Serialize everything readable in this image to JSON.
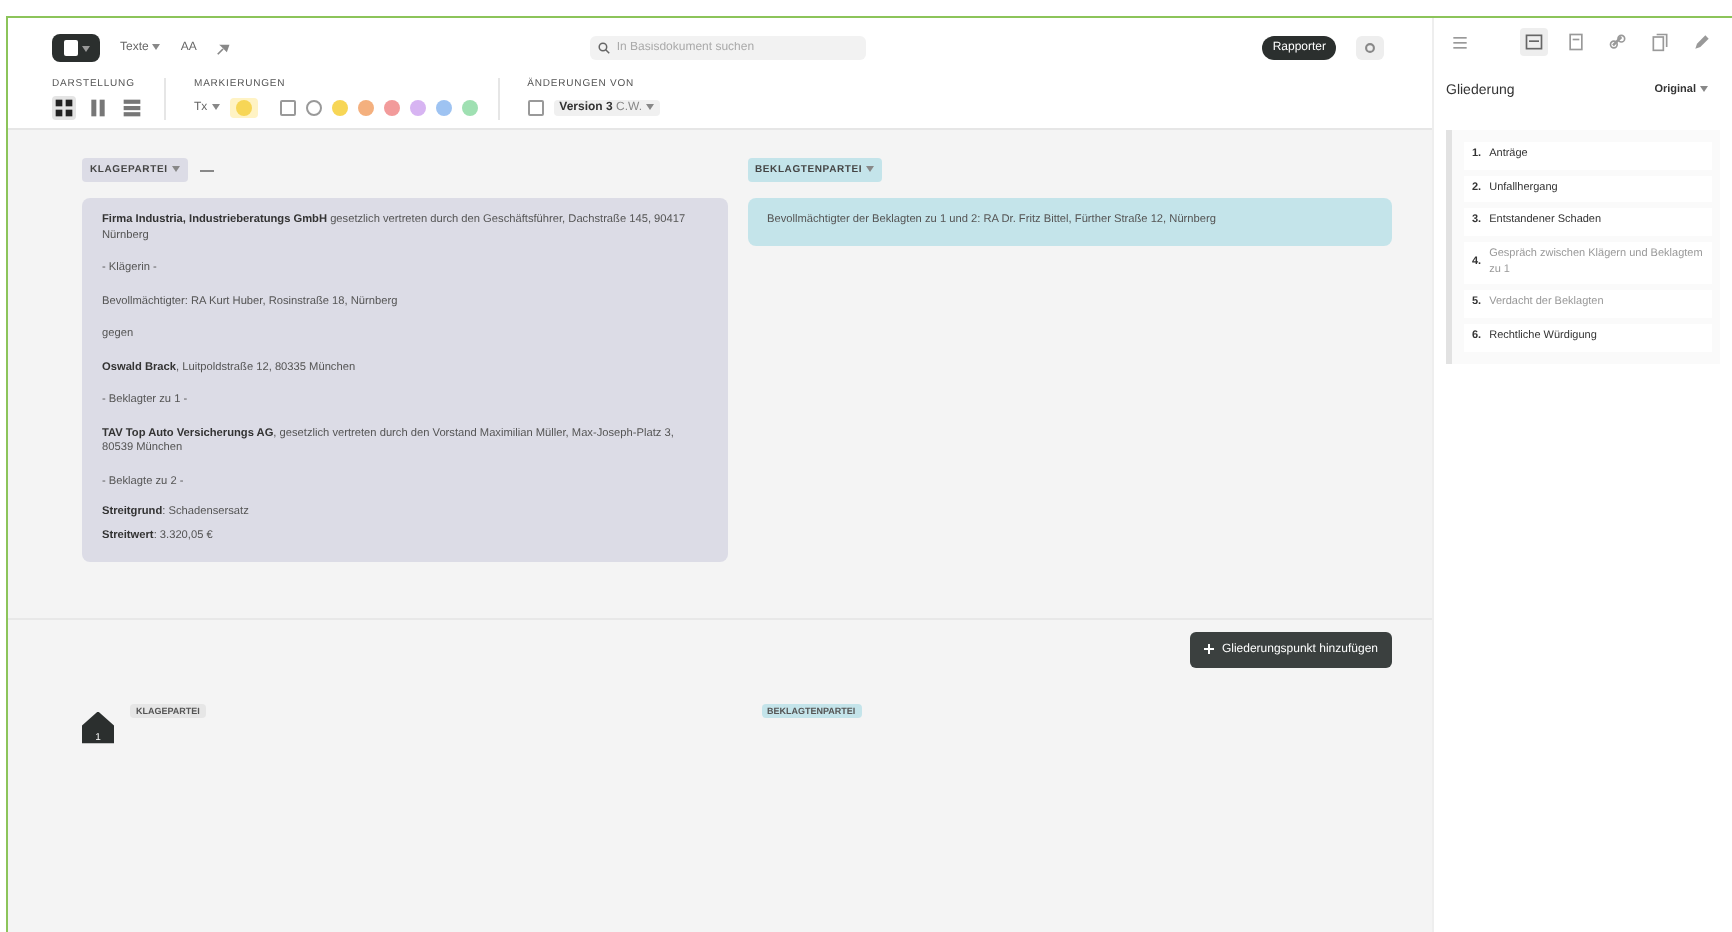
{
  "toolbar": {
    "document_menu": "Texte",
    "text_size": "AA",
    "search": {
      "placeholder": "In Basisdokument suchen"
    },
    "report_button": "Rapporter"
  },
  "view_group": {
    "label": "DARSTELLUNG",
    "views": [
      {
        "kind": "grid",
        "selected": true
      },
      {
        "kind": "columns",
        "selected": false
      },
      {
        "kind": "rows",
        "selected": false
      }
    ]
  },
  "marker_group": {
    "label": "MARKIERUNGEN",
    "text_style": "Tx",
    "pens": [
      {
        "color": "#f7d656"
      }
    ],
    "toggles": [
      {
        "kind": "square",
        "checked": false
      },
      {
        "kind": "round",
        "checked": false
      }
    ],
    "colors": [
      {
        "color": "#f7d656"
      },
      {
        "color": "#f4b07e"
      },
      {
        "color": "#f29b9b"
      },
      {
        "color": "#d7b4f2"
      },
      {
        "color": "#9ec3f2"
      },
      {
        "color": "#9fe0b2"
      }
    ]
  },
  "changes_group": {
    "label": "ÄNDERUNGEN VON",
    "version": "Version 3",
    "author": "C.W.",
    "checked": false
  },
  "parties": [
    {
      "kind": "plaintiff",
      "tag": "KLAGEPARTEI",
      "paragraphs": [
        "**Firma Industria, Industrieberatungs GmbH** gesetzlich vertreten durch den Geschäftsführer, Dachstraße 145, 90417 Nürnberg",
        "- Klägerin -",
        "Bevollmächtigter: RA Kurt Huber, Rosinstraße 18, Nürnberg",
        "gegen",
        "**Oswald Brack**, Luitpoldstraße 12, 80335 München",
        "- Beklagter zu 1 -",
        "**TAV Top Auto Versicherungs AG**, gesetzlich vertreten durch den Vorstand Maximilian Müller, Max-Joseph-Platz 3, 80539 München",
        "- Beklagte zu 2 -"
      ],
      "facts": [
        "**Streitgrund**: Schadensersatz",
        "**Streitwert**: 3.320,05 €"
      ]
    },
    {
      "kind": "defendant",
      "tag": "BEKLAGTENPARTEI",
      "paragraphs": [
        "Bevollmächtigter der Beklagten zu 1 und 2: RA Dr. Fritz Bittel, Fürther Straße 12, Nürnberg"
      ]
    }
  ],
  "add_button": "Gliederungspunkt hinzufügen",
  "next_section": {
    "number": "1",
    "tags": [
      "KLAGEPARTEI",
      "BEKLAGTENPARTEI"
    ]
  },
  "sidebar": {
    "tools": [
      {
        "kind": "list",
        "selected": false
      },
      {
        "kind": "outline",
        "selected": true
      },
      {
        "kind": "doc",
        "selected": false
      },
      {
        "kind": "link",
        "selected": false
      },
      {
        "kind": "copy",
        "selected": false
      },
      {
        "kind": "pen",
        "selected": false
      }
    ],
    "title": "Gliederung",
    "mode": "Original",
    "items": [
      {
        "number": "1.",
        "label": "Anträge",
        "muted": false
      },
      {
        "number": "2.",
        "label": "Unfallhergang",
        "muted": false
      },
      {
        "number": "3.",
        "label": "Entstandener Schaden",
        "muted": false
      },
      {
        "number": "4.",
        "label": "Gespräch zwischen Klägern und Beklagtem zu 1",
        "muted": true
      },
      {
        "number": "5.",
        "label": "Verdacht der Beklagten",
        "muted": true
      },
      {
        "number": "6.",
        "label": "Rechtliche Würdigung",
        "muted": false
      }
    ]
  }
}
